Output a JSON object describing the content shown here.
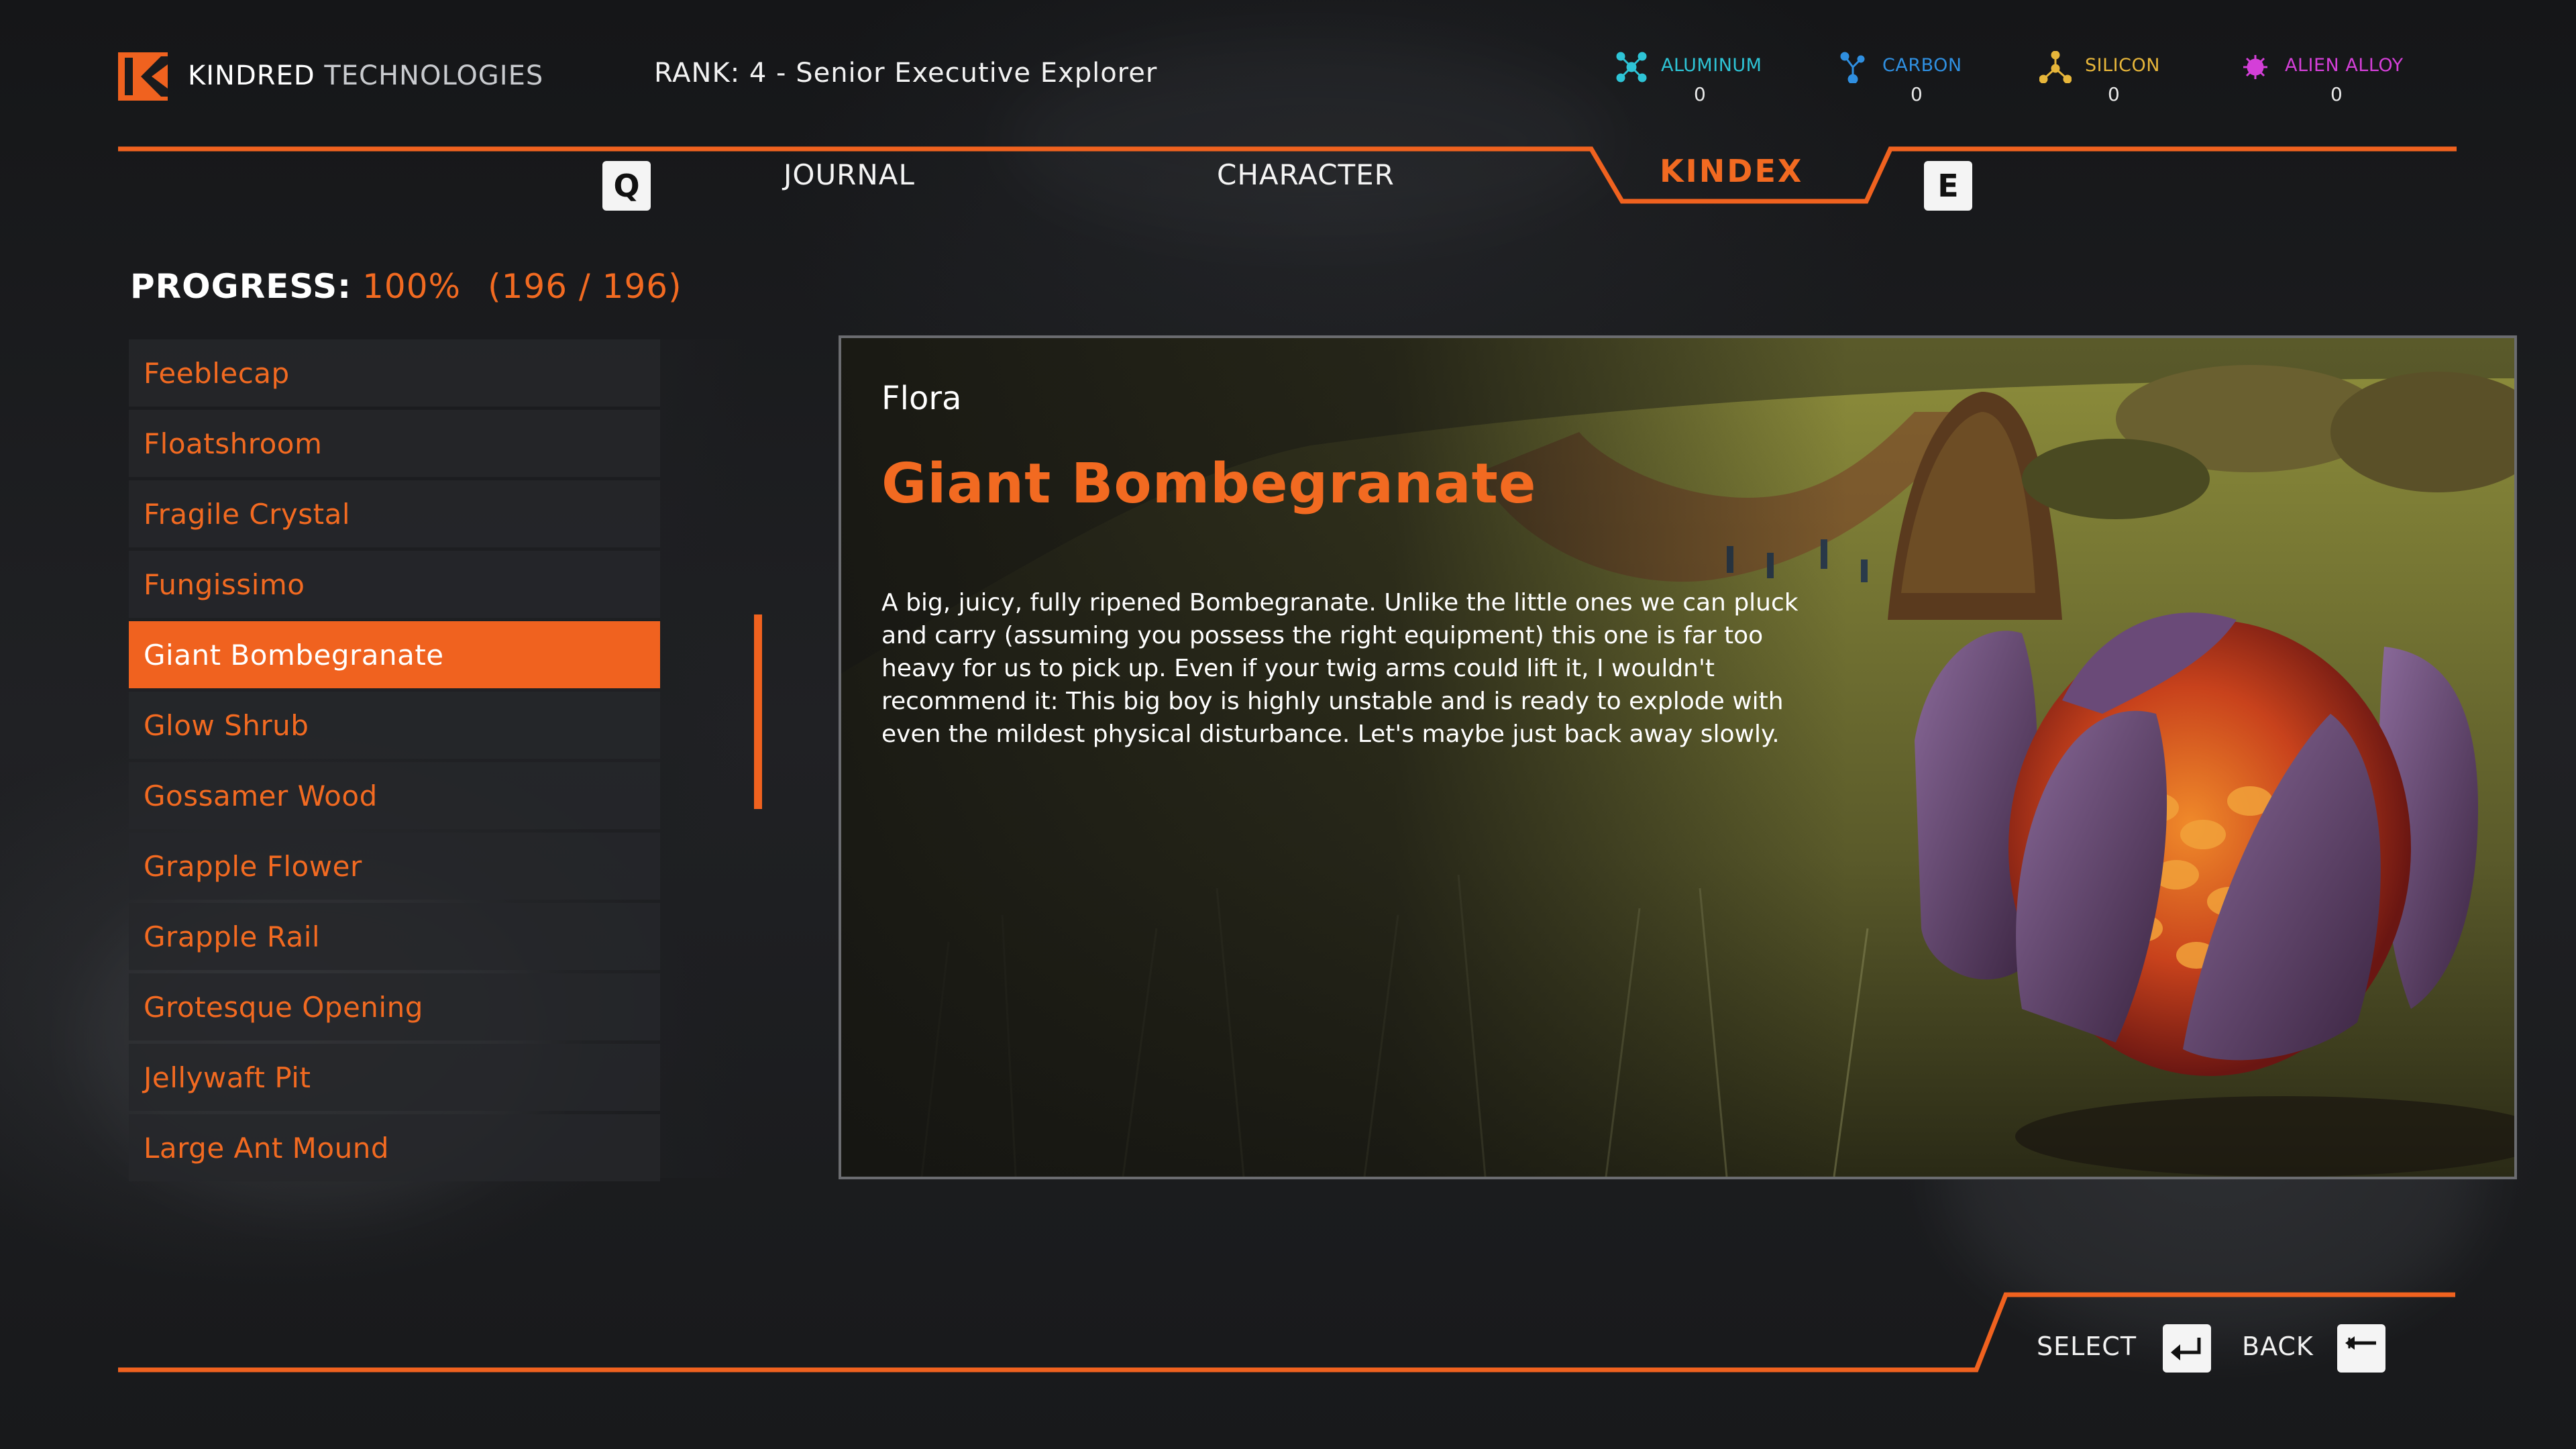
{
  "header": {
    "brand_primary": "KINDRED",
    "brand_secondary": "TECHNOLOGIES",
    "rank": "RANK: 4 - Senior Executive Explorer"
  },
  "resources": [
    {
      "name": "ALUMINUM",
      "count": "0",
      "color": "#2ec4d6",
      "icon": "aluminum-molecule-icon"
    },
    {
      "name": "CARBON",
      "count": "0",
      "color": "#2f8fe0",
      "icon": "carbon-molecule-icon"
    },
    {
      "name": "SILICON",
      "count": "0",
      "color": "#e7b63a",
      "icon": "silicon-molecule-icon"
    },
    {
      "name": "ALIEN ALLOY",
      "count": "0",
      "color": "#d43fd8",
      "icon": "alien-alloy-icon"
    }
  ],
  "tabs": {
    "prev_key": "Q",
    "next_key": "E",
    "journal": "JOURNAL",
    "character": "CHARACTER",
    "kindex": "KINDEX",
    "active": "KINDEX"
  },
  "progress": {
    "label": "PROGRESS:",
    "percent": "100%",
    "count": "(196 / 196)"
  },
  "list": {
    "items": [
      "Feeblecap",
      "Floatshroom",
      "Fragile Crystal",
      "Fungissimo",
      "Giant Bombegranate",
      "Glow Shrub",
      "Gossamer Wood",
      "Grapple Flower",
      "Grapple Rail",
      "Grotesque Opening",
      "Jellywaft Pit",
      "Large Ant Mound"
    ],
    "selected_index": 4
  },
  "entry": {
    "category": "Flora",
    "title": "Giant Bombegranate",
    "description": "A big, juicy, fully ripened Bombegranate. Unlike the little ones we can pluck and carry (assuming you possess the right equipment) this one is far too heavy for us to pick up. Even if your twig arms could lift it, I wouldn't recommend it: This big boy is highly unstable and is ready to explode with even the mildest physical disturbance. Let's maybe just back away slowly."
  },
  "footer": {
    "select_label": "SELECT",
    "back_label": "BACK"
  },
  "colors": {
    "accent": "#f26a21",
    "selected_bg": "#f0621f",
    "panel_bg": "#26272a"
  }
}
